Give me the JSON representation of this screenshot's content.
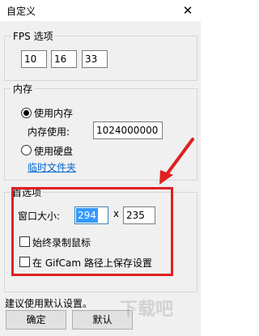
{
  "window": {
    "title": "自定义",
    "close_glyph": "✕"
  },
  "fps_group": {
    "label": "FPS 选项",
    "values": [
      "10",
      "16",
      "33"
    ]
  },
  "memory_group": {
    "label": "内存",
    "use_memory_label": "使用内存",
    "use_memory_selected": true,
    "memory_usage_label": "内存使用:",
    "memory_usage_value": "1024000000",
    "use_disk_label": "使用硬盘",
    "use_disk_selected": false,
    "temp_folder_link": "临时文件夹"
  },
  "preferences_group": {
    "label": "首选项",
    "window_size_label": "窗口大小:",
    "width_value": "294",
    "times_sign": "x",
    "height_value": "235",
    "always_record_cursor_label": "始终录制鼠标",
    "always_record_cursor_checked": false,
    "save_in_gifcam_path_label": "在 GifCam 路径上保存设置",
    "save_in_gifcam_path_checked": false
  },
  "hint_text": "建议使用默认设置。",
  "buttons": {
    "ok_label": "确定",
    "default_label": "默认"
  },
  "annotation": {
    "color": "#e02020"
  },
  "watermark": {
    "text": "下载吧"
  }
}
